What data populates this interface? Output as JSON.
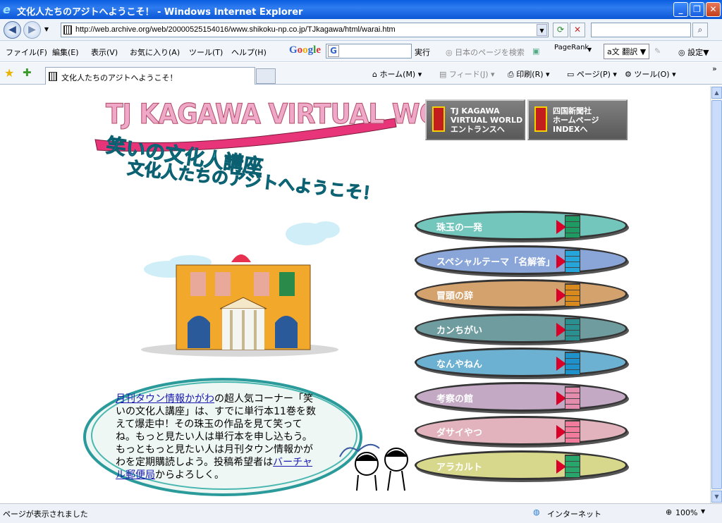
{
  "window": {
    "title": "文化人たちのアジトへようこそ！ - Windows Internet Explorer"
  },
  "address": {
    "url": "http://web.archive.org/web/20000525154016/www.shikoku-np.co.jp/TJkagawa/html/warai.htm"
  },
  "menu": {
    "items": [
      "ファイル(F)",
      "編集(E)",
      "表示(V)",
      "お気に入り(A)",
      "ツール(T)",
      "ヘルプ(H)"
    ]
  },
  "google_toolbar": {
    "logo": "Google",
    "run": "実行",
    "search_jp": "日本のページを検索",
    "pagerank": "PageRank",
    "translate": "翻訳",
    "settings": "設定"
  },
  "tabs": {
    "active_label": "文化人たちのアジトへようこそ！"
  },
  "command_bar": {
    "home": "ホーム(M)",
    "feeds": "フィード(J)",
    "print": "印刷(R)",
    "page": "ページ(P)",
    "tools": "ツール(O)"
  },
  "page": {
    "logo": "TJ KAGAWA VIRTUAL WORD",
    "headline1": "笑いの文化人講座",
    "headline2": "文化人たちのアジトへようこそ！",
    "top_buttons": [
      {
        "text": "TJ KAGAWA\nVIRTUAL WORLD\nエントランスへ"
      },
      {
        "text": "四国新聞社\nホームページ\nINDEXへ"
      }
    ],
    "nav": [
      {
        "label": "珠玉の一発",
        "color": "#72c6bb",
        "door": "#1f9a62"
      },
      {
        "label": "スペシャルテーマ「名解答」",
        "color": "#8aa6d9",
        "door": "#25a5d9"
      },
      {
        "label": "冒頭の辞",
        "color": "#d4a26c",
        "door": "#d88a1e"
      },
      {
        "label": "カンちがい",
        "color": "#6f9c9f",
        "door": "#2a8f8f"
      },
      {
        "label": "なんやねん",
        "color": "#6cb1d1",
        "door": "#1f92cc"
      },
      {
        "label": "考察の館",
        "color": "#c3a9c4",
        "door": "#e48cae"
      },
      {
        "label": "ダサイやつ",
        "color": "#e2b3bc",
        "door": "#f07b9b"
      },
      {
        "label": "アラカルト",
        "color": "#d8d88c",
        "door": "#28a56b"
      }
    ],
    "bubble": {
      "link1": "月刊タウン情報かがわ",
      "text1": "の超人気コーナー「笑いの文化人講座」は、すでに単行本11巻を数えて爆走中！その珠玉の作品を見て笑ってね。もっと見たい人は単行本を申し込もう。もっともっと見たい人は月刊タウン情報かがわを定期購読しよう。投稿希望者は",
      "link2": "バーチャル郵便局",
      "text2": "からよろしく。"
    }
  },
  "status": {
    "text": "ページが表示されました",
    "zone": "インターネット",
    "zoom": "100%"
  }
}
